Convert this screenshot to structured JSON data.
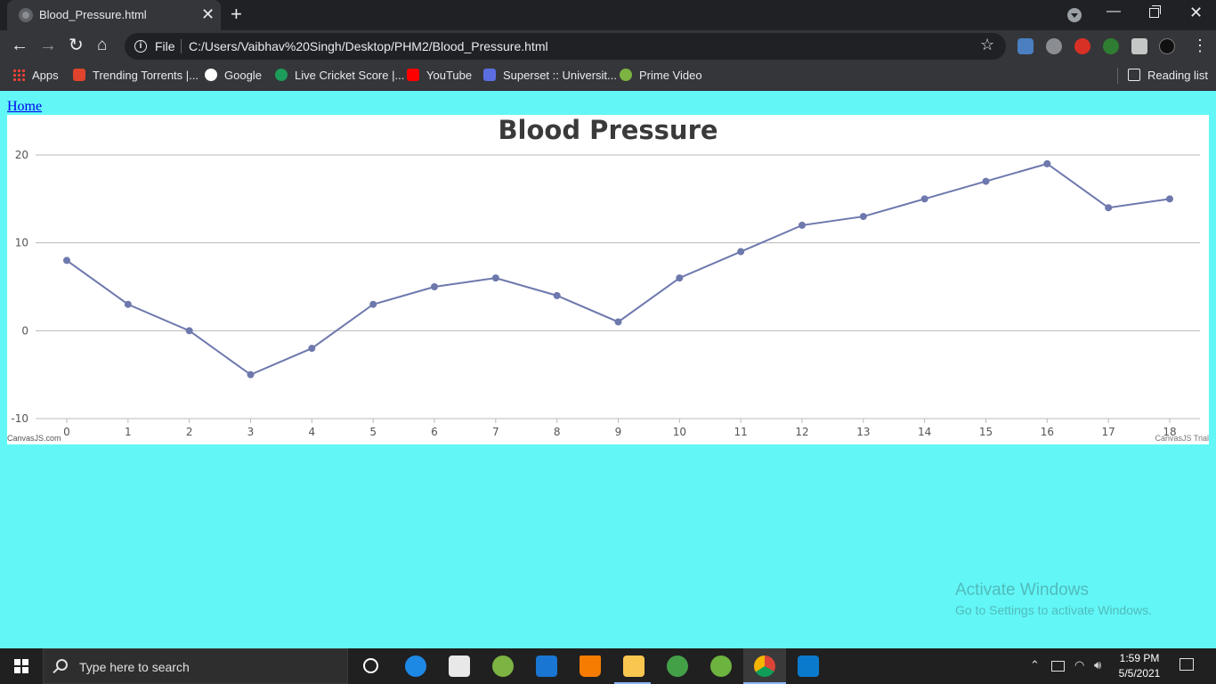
{
  "browser": {
    "tab_title": "Blood_Pressure.html",
    "new_tab_glyph": "+",
    "close_glyph": "✕",
    "file_label": "File",
    "url": "C:/Users/Vaibhav%20Singh/Desktop/PHM2/Blood_Pressure.html"
  },
  "bookmarks": [
    {
      "label": "Apps",
      "icon": "apps-grid-icon"
    },
    {
      "label": "Trending Torrents |...",
      "icon": "torrent-icon",
      "color": "#e0442c"
    },
    {
      "label": "Google",
      "icon": "google-icon",
      "color": "#ffffff"
    },
    {
      "label": "Live Cricket Score |...",
      "icon": "cricket-icon",
      "color": "#1d9b5a"
    },
    {
      "label": "YouTube",
      "icon": "youtube-icon",
      "color": "#ff0000"
    },
    {
      "label": "Superset :: Universit...",
      "icon": "superset-icon",
      "color": "#5b6ee1"
    },
    {
      "label": "Prime Video",
      "icon": "prime-video-icon",
      "color": "#7cb342"
    }
  ],
  "reading_list": "Reading list",
  "page": {
    "home_link": "Home"
  },
  "chart_data": {
    "type": "line",
    "title": "Blood Pressure",
    "x": [
      0,
      1,
      2,
      3,
      4,
      5,
      6,
      7,
      8,
      9,
      10,
      11,
      12,
      13,
      14,
      15,
      16,
      17,
      18
    ],
    "series": [
      {
        "values": [
          8,
          3,
          0,
          -5,
          -2,
          3,
          5,
          6,
          4,
          1,
          6,
          9,
          12,
          13,
          15,
          17,
          19,
          14,
          15
        ],
        "color": "#6d78ad"
      }
    ],
    "y_ticks": [
      -10,
      0,
      10,
      20
    ],
    "ylim": [
      -10,
      20
    ],
    "grid": true,
    "credit_left": "CanvasJS.com",
    "credit_right": "CanvasJS Trial"
  },
  "watermark": {
    "line1": "Activate Windows",
    "line2": "Go to Settings to activate Windows."
  },
  "taskbar": {
    "search_placeholder": "Type here to search",
    "time": "1:59 PM",
    "date": "5/5/2021"
  }
}
